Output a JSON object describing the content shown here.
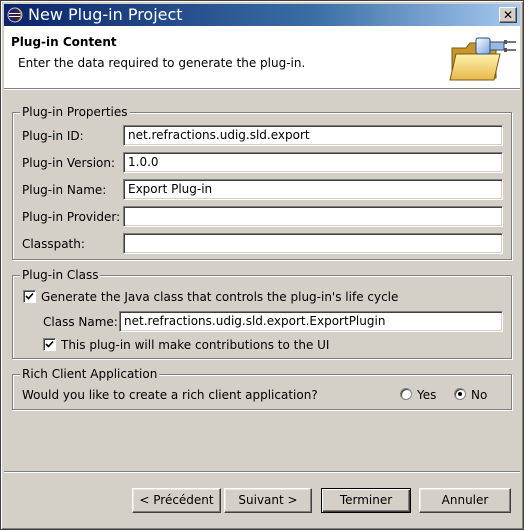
{
  "window": {
    "title": "New Plug-in Project",
    "close_label": "✕"
  },
  "banner": {
    "title": "Plug-in Content",
    "message": "Enter the data required to generate the plug-in.",
    "image_icon": "folder-plug-icon"
  },
  "properties": {
    "group_title": "Plug-in Properties",
    "fields": [
      {
        "label": "Plug-in ID:",
        "value": "net.refractions.udig.sld.export"
      },
      {
        "label": "Plug-in Version:",
        "value": "1.0.0"
      },
      {
        "label": "Plug-in Name:",
        "value": "Export Plug-in"
      },
      {
        "label": "Plug-in Provider:",
        "value": ""
      },
      {
        "label": "Classpath:",
        "value": ""
      }
    ]
  },
  "plugin_class": {
    "group_title": "Plug-in Class",
    "generate_label": "Generate the Java class that controls the plug-in's life cycle",
    "generate_checked": true,
    "class_name_label": "Class Name:",
    "class_name_value": "net.refractions.udig.sld.export.ExportPlugin",
    "contributions_label": "This plug-in will make contributions to the UI",
    "contributions_checked": true
  },
  "rich_client": {
    "group_title": "Rich Client Application",
    "question": "Would you like to create a rich client application?",
    "yes_label": "Yes",
    "no_label": "No",
    "selected": "No"
  },
  "buttons": {
    "back": "< Précédent",
    "next": "Suivant >",
    "finish": "Terminer",
    "cancel": "Annuler"
  }
}
